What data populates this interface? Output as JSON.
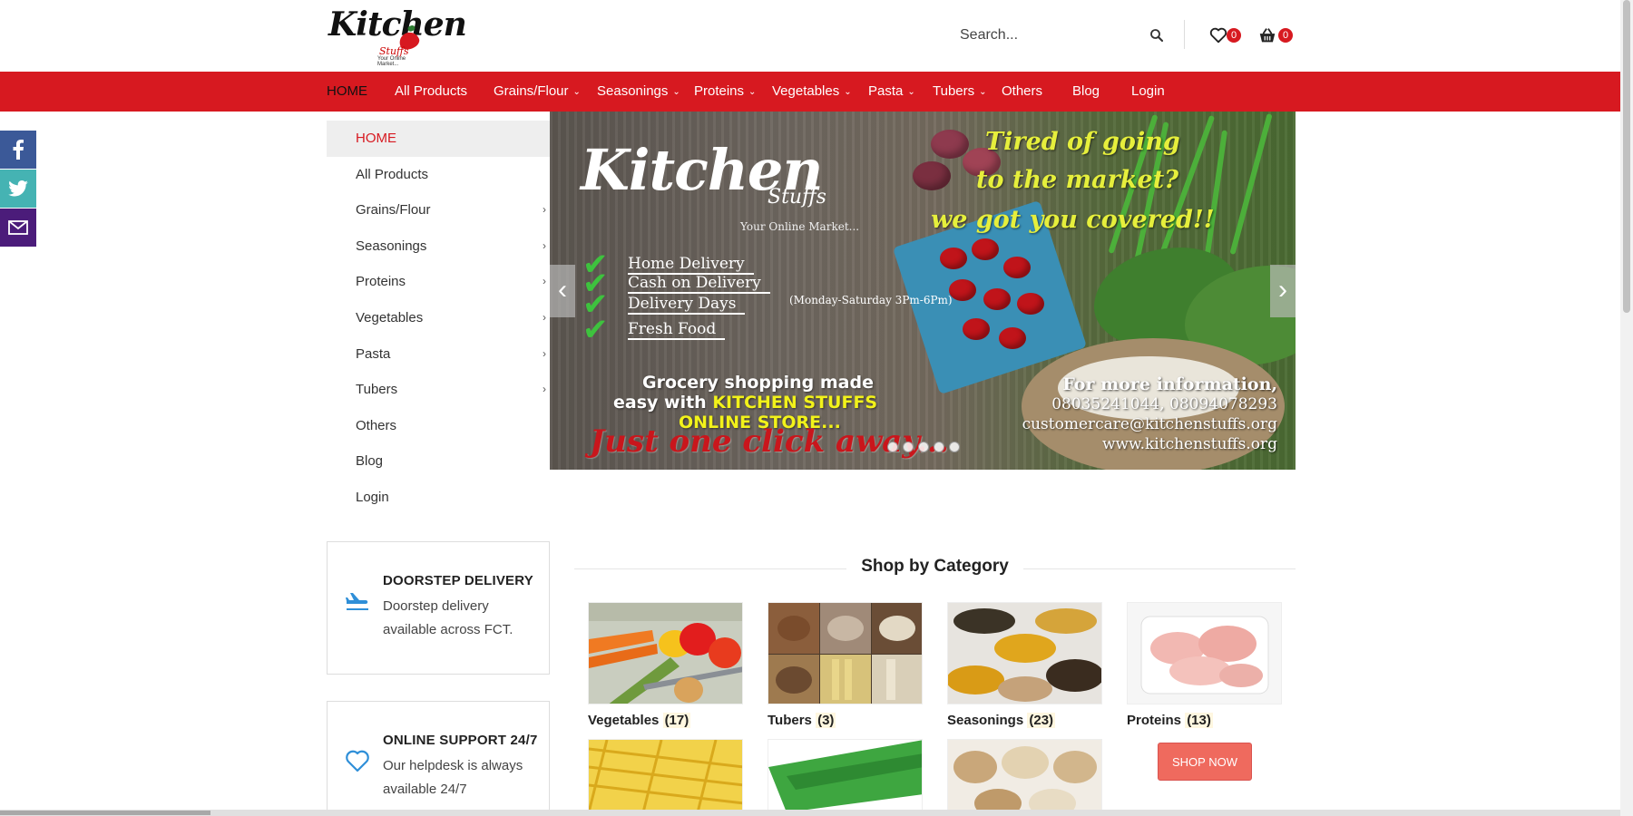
{
  "header": {
    "logo": {
      "word": "Kitchen",
      "sub": "Stuffs",
      "tag": "Your Online Market..."
    },
    "search": {
      "placeholder": "Search..."
    },
    "wishlist_count": "0",
    "cart_count": "0"
  },
  "nav": {
    "items": [
      {
        "label": "HOME",
        "dropdown": false,
        "active": true
      },
      {
        "label": "All Products",
        "dropdown": false
      },
      {
        "label": "Grains/Flour",
        "dropdown": true
      },
      {
        "label": "Seasonings",
        "dropdown": true
      },
      {
        "label": "Proteins",
        "dropdown": true
      },
      {
        "label": "Vegetables",
        "dropdown": true
      },
      {
        "label": "Pasta",
        "dropdown": true
      },
      {
        "label": "Tubers",
        "dropdown": true
      },
      {
        "label": "Others",
        "dropdown": false
      },
      {
        "label": "Blog",
        "dropdown": false
      },
      {
        "label": "Login",
        "dropdown": false
      }
    ],
    "chevron": "⌄"
  },
  "social": [
    {
      "name": "facebook-icon",
      "glyph": "f"
    },
    {
      "name": "twitter-icon",
      "glyph": "t"
    },
    {
      "name": "email-icon",
      "glyph": "✉"
    }
  ],
  "sidebar": {
    "items": [
      {
        "label": "HOME",
        "arrow": false,
        "active": true
      },
      {
        "label": "All Products",
        "arrow": false
      },
      {
        "label": "Grains/Flour",
        "arrow": true
      },
      {
        "label": "Seasonings",
        "arrow": true
      },
      {
        "label": "Proteins",
        "arrow": true
      },
      {
        "label": "Vegetables",
        "arrow": true
      },
      {
        "label": "Pasta",
        "arrow": true
      },
      {
        "label": "Tubers",
        "arrow": true
      },
      {
        "label": "Others",
        "arrow": false
      },
      {
        "label": "Blog",
        "arrow": false
      },
      {
        "label": "Login",
        "arrow": false
      }
    ],
    "arrow_glyph": "›"
  },
  "slider": {
    "brand": "Kitchen",
    "brand_sub": "Stuffs",
    "brand_tag": "Your Online Market...",
    "features": [
      {
        "text": "Home Delivery"
      },
      {
        "text": "Cash on Delivery"
      },
      {
        "text": "Delivery Days",
        "note": "(Monday-Saturday 3Pm-6Pm)"
      },
      {
        "text": "Fresh Food"
      }
    ],
    "headline1": "Tired of going",
    "headline2": "to the market?",
    "headline3": "we got you covered!!",
    "promo1": "Grocery shopping made",
    "promo2_white": "easy with ",
    "promo2_yellow": "KITCHEN STUFFS",
    "promo3": "ONLINE STORE...",
    "click": "Just one click away...",
    "info_title": "For more information,",
    "info_phone": "08035241044, 08094078293",
    "info_email": "customercare@kitchenstuffs.org",
    "info_web": "www.kitchenstuffs.org",
    "prev": "‹",
    "next": "›",
    "dot_count": 5,
    "colors": {
      "headline": "#e6ef3c",
      "check": "#3ec23e",
      "click": "#c9161c"
    }
  },
  "features": [
    {
      "icon": "airplane-icon",
      "title": "DOORSTEP DELIVERY",
      "desc": "Doorstep delivery available across FCT."
    },
    {
      "icon": "heart-icon",
      "title": "ONLINE SUPPORT 24/7",
      "desc": "Our helpdesk is always available 24/7"
    }
  ],
  "categories": {
    "title": "Shop by Category",
    "items": [
      {
        "name": "Vegetables",
        "count": "(17)"
      },
      {
        "name": "Tubers",
        "count": "(3)"
      },
      {
        "name": "Seasonings",
        "count": "(23)"
      },
      {
        "name": "Proteins",
        "count": "(13)"
      }
    ],
    "shop_now": "SHOP NOW"
  },
  "colors": {
    "brand_red": "#d71920",
    "shop_button": "#ef6a5e",
    "icon_blue": "#2f8fd8"
  }
}
